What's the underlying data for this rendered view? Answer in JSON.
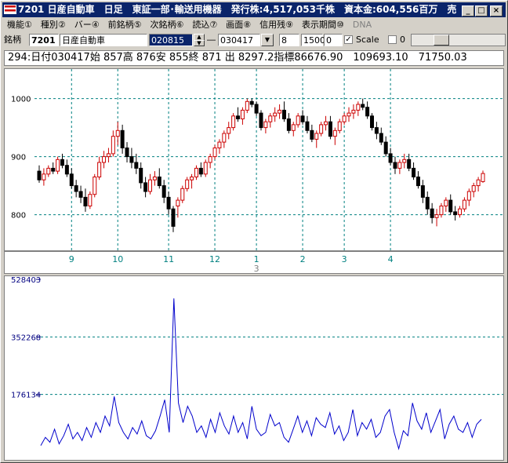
{
  "window": {
    "title": "7201 日産自動車　日足　東証一部･輸送用機器　発行株:4,517,053千株　資本金:604,556百万　売",
    "minimize_glyph": "_",
    "maximize_glyph": "□",
    "close_glyph": "×"
  },
  "menu": [
    {
      "label": "機能①",
      "enabled": true
    },
    {
      "label": "種別②",
      "enabled": true
    },
    {
      "label": "バー④",
      "enabled": true
    },
    {
      "label": "前銘柄⑤",
      "enabled": true
    },
    {
      "label": "次銘柄⑥",
      "enabled": true
    },
    {
      "label": "読込⑦",
      "enabled": true
    },
    {
      "label": "画面⑧",
      "enabled": true
    },
    {
      "label": "信用残⑨",
      "enabled": true
    },
    {
      "label": "表示期間⑩",
      "enabled": true
    },
    {
      "label": "DNA",
      "enabled": false
    }
  ],
  "toolbar": {
    "code_label": "銘柄",
    "code_value": "7201",
    "name_value": "日産自動車",
    "from_date": "020815",
    "range_sep": "―",
    "to_date": "030417",
    "field_a": "8",
    "field_b": "1500",
    "field_c": "0",
    "scale_checked": true,
    "scale_label": "Scale",
    "field_d": "0",
    "check_glyph": "✓",
    "dropdown_glyph": "▼",
    "spin_up_glyph": "▲",
    "spin_down_glyph": "▼"
  },
  "info_line": "294:日付030417始 857高 876安 855終 871 出 8297.2指標86676.90　109693.10　71750.03",
  "chart_data": [
    {
      "type": "candlestick",
      "name": "price",
      "ylim": [
        740,
        1040
      ],
      "yticks": [
        800,
        900,
        1000
      ],
      "x_month_labels": [
        {
          "label": "9",
          "idx": 7
        },
        {
          "label": "10",
          "idx": 17
        },
        {
          "label": "11",
          "idx": 28
        },
        {
          "label": "12",
          "idx": 38
        },
        {
          "label": "1",
          "idx": 47
        },
        {
          "label": "2",
          "idx": 57
        },
        {
          "label": "3",
          "idx": 66
        },
        {
          "label": "4",
          "idx": 76
        }
      ],
      "year_marker": "3",
      "grid": true,
      "candles": [
        [
          875,
          885,
          855,
          860
        ],
        [
          860,
          880,
          850,
          870
        ],
        [
          870,
          885,
          865,
          880
        ],
        [
          880,
          890,
          870,
          875
        ],
        [
          875,
          900,
          870,
          895
        ],
        [
          895,
          905,
          880,
          885
        ],
        [
          885,
          895,
          865,
          870
        ],
        [
          870,
          880,
          845,
          850
        ],
        [
          850,
          860,
          830,
          840
        ],
        [
          840,
          850,
          820,
          830
        ],
        [
          830,
          845,
          805,
          815
        ],
        [
          815,
          840,
          810,
          835
        ],
        [
          835,
          870,
          830,
          865
        ],
        [
          865,
          900,
          860,
          890
        ],
        [
          890,
          910,
          880,
          900
        ],
        [
          900,
          915,
          890,
          905
        ],
        [
          905,
          945,
          900,
          935
        ],
        [
          935,
          960,
          920,
          945
        ],
        [
          945,
          955,
          905,
          915
        ],
        [
          915,
          925,
          890,
          900
        ],
        [
          900,
          915,
          880,
          890
        ],
        [
          890,
          905,
          870,
          880
        ],
        [
          880,
          890,
          845,
          855
        ],
        [
          855,
          865,
          830,
          840
        ],
        [
          840,
          870,
          835,
          860
        ],
        [
          860,
          875,
          850,
          865
        ],
        [
          865,
          880,
          845,
          850
        ],
        [
          850,
          860,
          820,
          830
        ],
        [
          830,
          840,
          800,
          810
        ],
        [
          810,
          815,
          770,
          780
        ],
        [
          815,
          830,
          795,
          825
        ],
        [
          825,
          850,
          820,
          845
        ],
        [
          845,
          865,
          840,
          860
        ],
        [
          860,
          870,
          845,
          865
        ],
        [
          865,
          885,
          860,
          880
        ],
        [
          880,
          890,
          865,
          870
        ],
        [
          870,
          895,
          865,
          890
        ],
        [
          890,
          905,
          880,
          900
        ],
        [
          900,
          920,
          895,
          915
        ],
        [
          915,
          930,
          905,
          925
        ],
        [
          925,
          945,
          915,
          940
        ],
        [
          940,
          960,
          930,
          950
        ],
        [
          950,
          975,
          945,
          970
        ],
        [
          970,
          985,
          960,
          965
        ],
        [
          965,
          985,
          955,
          980
        ],
        [
          980,
          1000,
          975,
          995
        ],
        [
          995,
          1000,
          985,
          990
        ],
        [
          990,
          995,
          970,
          975
        ],
        [
          975,
          980,
          945,
          950
        ],
        [
          950,
          965,
          940,
          960
        ],
        [
          960,
          975,
          950,
          970
        ],
        [
          970,
          985,
          960,
          975
        ],
        [
          975,
          990,
          965,
          980
        ],
        [
          980,
          995,
          960,
          965
        ],
        [
          965,
          975,
          940,
          945
        ],
        [
          945,
          960,
          935,
          955
        ],
        [
          955,
          975,
          950,
          970
        ],
        [
          970,
          980,
          955,
          960
        ],
        [
          960,
          970,
          940,
          945
        ],
        [
          945,
          955,
          925,
          930
        ],
        [
          930,
          945,
          915,
          940
        ],
        [
          940,
          960,
          935,
          955
        ],
        [
          955,
          970,
          945,
          960
        ],
        [
          960,
          970,
          930,
          935
        ],
        [
          935,
          950,
          920,
          945
        ],
        [
          945,
          965,
          940,
          960
        ],
        [
          960,
          975,
          955,
          970
        ],
        [
          970,
          985,
          960,
          975
        ],
        [
          975,
          990,
          965,
          980
        ],
        [
          980,
          995,
          970,
          990
        ],
        [
          990,
          1000,
          980,
          985
        ],
        [
          985,
          995,
          965,
          970
        ],
        [
          970,
          975,
          945,
          950
        ],
        [
          950,
          960,
          930,
          940
        ],
        [
          940,
          950,
          920,
          925
        ],
        [
          925,
          935,
          900,
          905
        ],
        [
          905,
          915,
          885,
          890
        ],
        [
          890,
          900,
          870,
          880
        ],
        [
          880,
          895,
          870,
          890
        ],
        [
          890,
          905,
          880,
          895
        ],
        [
          895,
          905,
          875,
          880
        ],
        [
          880,
          890,
          860,
          865
        ],
        [
          865,
          875,
          845,
          850
        ],
        [
          850,
          860,
          820,
          830
        ],
        [
          830,
          840,
          800,
          810
        ],
        [
          810,
          820,
          785,
          795
        ],
        [
          795,
          810,
          780,
          800
        ],
        [
          800,
          820,
          795,
          815
        ],
        [
          815,
          830,
          805,
          825
        ],
        [
          825,
          835,
          800,
          805
        ],
        [
          805,
          815,
          790,
          800
        ],
        [
          800,
          815,
          795,
          810
        ],
        [
          810,
          830,
          805,
          825
        ],
        [
          825,
          845,
          815,
          840
        ],
        [
          840,
          855,
          830,
          850
        ],
        [
          850,
          865,
          840,
          860
        ],
        [
          857,
          876,
          855,
          871
        ]
      ]
    },
    {
      "type": "line",
      "name": "volume",
      "ylim": [
        0,
        528403
      ],
      "yticks": [
        176134,
        352268,
        528403
      ],
      "series": [
        {
          "color": "#0000cc",
          "values": [
            20000,
            45000,
            30000,
            70000,
            25000,
            50000,
            85000,
            40000,
            60000,
            35000,
            75000,
            45000,
            90000,
            60000,
            110000,
            80000,
            170000,
            90000,
            60000,
            40000,
            75000,
            55000,
            95000,
            50000,
            40000,
            65000,
            110000,
            160000,
            60000,
            470000,
            150000,
            90000,
            140000,
            110000,
            60000,
            80000,
            45000,
            100000,
            60000,
            120000,
            80000,
            55000,
            110000,
            60000,
            90000,
            40000,
            140000,
            70000,
            50000,
            60000,
            115000,
            80000,
            90000,
            45000,
            30000,
            70000,
            110000,
            60000,
            95000,
            50000,
            105000,
            85000,
            75000,
            120000,
            55000,
            80000,
            35000,
            60000,
            130000,
            50000,
            90000,
            70000,
            100000,
            45000,
            60000,
            110000,
            130000,
            60000,
            10000,
            65000,
            50000,
            150000,
            95000,
            70000,
            120000,
            60000,
            95000,
            130000,
            40000,
            85000,
            110000,
            70000,
            60000,
            90000,
            45000,
            85000,
            100000
          ]
        }
      ]
    }
  ]
}
